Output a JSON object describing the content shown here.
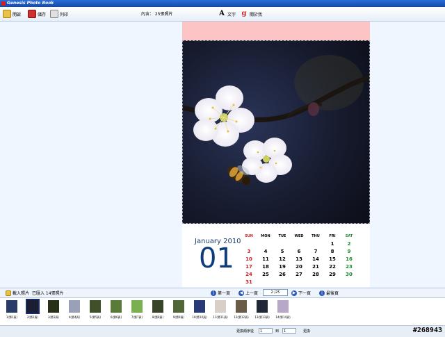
{
  "window": {
    "title": "Genesis Photo Book"
  },
  "toolbar": {
    "open_label": "開啟",
    "save_label": "儲存",
    "print_label": "列印",
    "content_count": "內含： 25張照片",
    "font_label": "文字",
    "font_icon_glyph": "A",
    "about_label": "關於我",
    "about_icon_glyph": "g"
  },
  "calendar": {
    "month_year": "January 2010",
    "day_number": "01",
    "weekdays": [
      "SUN",
      "MON",
      "TUE",
      "WED",
      "THU",
      "FRI",
      "SAT"
    ],
    "weeks": [
      [
        "",
        "",
        "",
        "",
        "",
        "1",
        "2"
      ],
      [
        "3",
        "4",
        "5",
        "6",
        "7",
        "8",
        "9"
      ],
      [
        "10",
        "11",
        "12",
        "13",
        "14",
        "15",
        "16"
      ],
      [
        "17",
        "18",
        "19",
        "20",
        "21",
        "22",
        "23"
      ],
      [
        "24",
        "25",
        "26",
        "27",
        "28",
        "29",
        "30"
      ],
      [
        "31",
        "",
        "",
        "",
        "",
        "",
        ""
      ]
    ],
    "colors": {
      "sunday": "#d02020",
      "saturday": "#1a8a2a",
      "weekday": "#000000"
    }
  },
  "navigation": {
    "load_photos": "載入照片",
    "loaded_count": "已匯入 14張照片",
    "first_page": "第一頁",
    "prev_page": "上一頁",
    "page_indicator": "2 /25",
    "next_page": "下一頁",
    "last_page": "最後頁"
  },
  "thumbnails": [
    {
      "label": "1(第1頁)",
      "color": "#2a3a6a",
      "selected": false
    },
    {
      "label": "2(第2頁)",
      "color": "#1a1e30",
      "selected": true
    },
    {
      "label": "3(第3頁)",
      "color": "#283018",
      "selected": false
    },
    {
      "label": "4(第4頁)",
      "color": "#9aa0b8",
      "selected": false
    },
    {
      "label": "5(第5頁)",
      "color": "#405028",
      "selected": false
    },
    {
      "label": "6(第6頁)",
      "color": "#5a7a38",
      "selected": false
    },
    {
      "label": "7(第7頁)",
      "color": "#7ab050",
      "selected": false
    },
    {
      "label": "8(第8頁)",
      "color": "#384428",
      "selected": false
    },
    {
      "label": "9(第9頁)",
      "color": "#506838",
      "selected": false
    },
    {
      "label": "10(第10頁)",
      "color": "#283a78",
      "selected": false
    },
    {
      "label": "11(第11頁)",
      "color": "#d8d0c8",
      "selected": false
    },
    {
      "label": "12(第12頁)",
      "color": "#6a5a48",
      "selected": false
    },
    {
      "label": "13(第13頁)",
      "color": "#202838",
      "selected": false
    },
    {
      "label": "14(第14頁)",
      "color": "#b8a8c8",
      "selected": false
    }
  ],
  "statusbar": {
    "reorder_label": "更換順序從",
    "from_value": "1",
    "to_label": "到",
    "to_value": "1",
    "swap_button": "更換"
  },
  "watermark": "#268943"
}
